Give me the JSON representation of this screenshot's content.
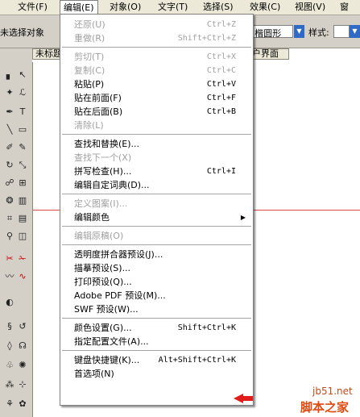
{
  "menubar": {
    "items": [
      {
        "label": "文件(F)",
        "active": false
      },
      {
        "label": "编辑(E)",
        "active": true
      },
      {
        "label": "对象(O)",
        "active": false
      },
      {
        "label": "文字(T)",
        "active": false
      },
      {
        "label": "选择(S)",
        "active": false
      },
      {
        "label": "效果(C)",
        "active": false
      },
      {
        "label": "视图(V)",
        "active": false
      },
      {
        "label": "窗",
        "active": false
      }
    ]
  },
  "control": {
    "status_text": "未选择对象",
    "font_value": "t. 楷圆形",
    "style_label": "样式:",
    "style_value": ""
  },
  "document": {
    "tab_title": "未标题",
    "tab2_title": "户界面"
  },
  "menu": {
    "items": [
      {
        "type": "item",
        "label": "还原(U)",
        "shortcut": "Ctrl+Z",
        "disabled": true
      },
      {
        "type": "item",
        "label": "重做(R)",
        "shortcut": "Shift+Ctrl+Z",
        "disabled": true
      },
      {
        "type": "sep"
      },
      {
        "type": "item",
        "label": "剪切(T)",
        "shortcut": "Ctrl+X",
        "disabled": true
      },
      {
        "type": "item",
        "label": "复制(C)",
        "shortcut": "Ctrl+C",
        "disabled": true
      },
      {
        "type": "item",
        "label": "粘贴(P)",
        "shortcut": "Ctrl+V",
        "disabled": false
      },
      {
        "type": "item",
        "label": "贴在前面(F)",
        "shortcut": "Ctrl+F",
        "disabled": false
      },
      {
        "type": "item",
        "label": "贴在后面(B)",
        "shortcut": "Ctrl+B",
        "disabled": false
      },
      {
        "type": "item",
        "label": "清除(L)",
        "shortcut": "",
        "disabled": true
      },
      {
        "type": "sep"
      },
      {
        "type": "item",
        "label": "查找和替换(E)...",
        "shortcut": "",
        "disabled": false
      },
      {
        "type": "item",
        "label": "查找下一个(X)",
        "shortcut": "",
        "disabled": true
      },
      {
        "type": "item",
        "label": "拼写检查(H)...",
        "shortcut": "Ctrl+I",
        "disabled": false
      },
      {
        "type": "item",
        "label": "编辑自定词典(D)...",
        "shortcut": "",
        "disabled": false
      },
      {
        "type": "sep"
      },
      {
        "type": "item",
        "label": "定义图案(I)...",
        "shortcut": "",
        "disabled": true
      },
      {
        "type": "item",
        "label": "编辑颜色",
        "shortcut": "",
        "disabled": false,
        "submenu": true
      },
      {
        "type": "sep"
      },
      {
        "type": "item",
        "label": "编辑原稿(O)",
        "shortcut": "",
        "disabled": true
      },
      {
        "type": "sep"
      },
      {
        "type": "item",
        "label": "透明度拼合器预设(J)...",
        "shortcut": "",
        "disabled": false
      },
      {
        "type": "item",
        "label": "描摹预设(S)...",
        "shortcut": "",
        "disabled": false
      },
      {
        "type": "item",
        "label": "打印预设(Q)...",
        "shortcut": "",
        "disabled": false
      },
      {
        "type": "item",
        "label": "Adobe PDF 预设(M)...",
        "shortcut": "",
        "disabled": false
      },
      {
        "type": "item",
        "label": "SWF 预设(W)...",
        "shortcut": "",
        "disabled": false
      },
      {
        "type": "sep"
      },
      {
        "type": "item",
        "label": "颜色设置(G)...",
        "shortcut": "Shift+Ctrl+K",
        "disabled": false
      },
      {
        "type": "item",
        "label": "指定配置文件(A)...",
        "shortcut": "",
        "disabled": false
      },
      {
        "type": "sep"
      },
      {
        "type": "item",
        "label": "键盘快捷键(K)...",
        "shortcut": "Alt+Shift+Ctrl+K",
        "disabled": false
      },
      {
        "type": "item",
        "label": "首选项(N)",
        "shortcut": "",
        "disabled": false,
        "submenu": true
      }
    ]
  },
  "watermark": {
    "line1": "jb51.net",
    "line2": "脚本之家"
  },
  "colors": {
    "accent": "#316ac5",
    "arrow": "#e21b1b",
    "guide": "#e24a4a"
  }
}
